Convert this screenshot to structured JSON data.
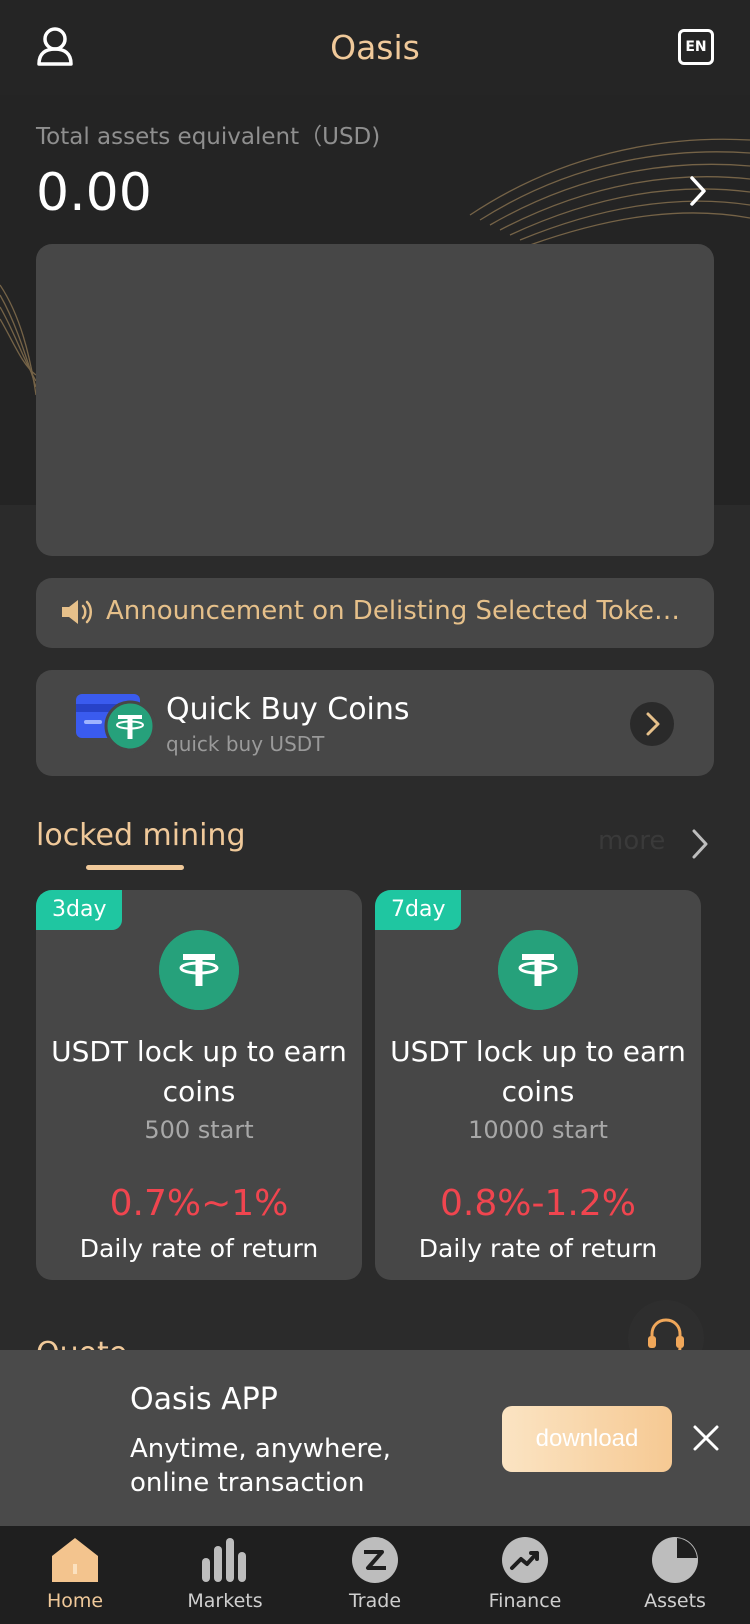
{
  "header": {
    "title": "Oasis",
    "lang_label": "EN"
  },
  "assets": {
    "label": "Total assets equivalent（USD)",
    "value": "0.00"
  },
  "notice": {
    "text": "Announcement on Delisting Selected Token Pairs"
  },
  "quick_buy": {
    "title": "Quick Buy Coins",
    "subtitle": "quick buy USDT"
  },
  "locked_mining": {
    "title": "locked mining",
    "more_label": "more",
    "cards": [
      {
        "badge": "3day",
        "title": "USDT lock up to earn coins",
        "start": "500 start",
        "rate": "0.7%~1%",
        "rate_label": "Daily rate of return"
      },
      {
        "badge": "7day",
        "title": "USDT lock up to earn coins",
        "start": "10000 start",
        "rate": "0.8%-1.2%",
        "rate_label": "Daily rate of return"
      }
    ]
  },
  "quote": {
    "title": "Quote"
  },
  "app_promo": {
    "title": "Oasis APP",
    "desc": "Anytime, anywhere, online transaction",
    "download_label": "download"
  },
  "tabs": [
    {
      "label": "Home",
      "icon": "home-icon",
      "active": true
    },
    {
      "label": "Markets",
      "icon": "bars-icon"
    },
    {
      "label": "Trade",
      "icon": "trade-icon"
    },
    {
      "label": "Finance",
      "icon": "trend-icon"
    },
    {
      "label": "Assets",
      "icon": "pie-icon"
    }
  ],
  "colors": {
    "accent": "#f0c99a",
    "badge": "#1fc6a1",
    "rate": "#f0454f",
    "tether": "#26a17b"
  }
}
